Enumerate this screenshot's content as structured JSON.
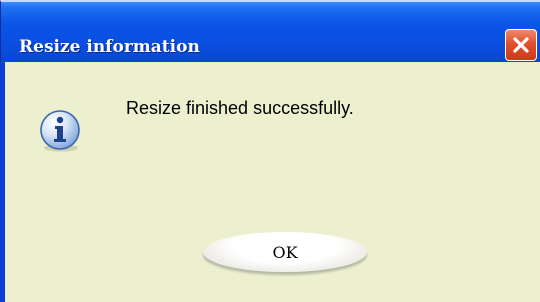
{
  "dialog": {
    "title": "Resize information",
    "message": "Resize finished successfully.",
    "ok_label": "OK",
    "icon": "info-icon",
    "close_icon": "close-icon"
  },
  "colors": {
    "titlebar": "#0b55e8",
    "body": "#ecf0cf",
    "close_button": "#e2502d",
    "icon_blue": "#2a64c0"
  }
}
